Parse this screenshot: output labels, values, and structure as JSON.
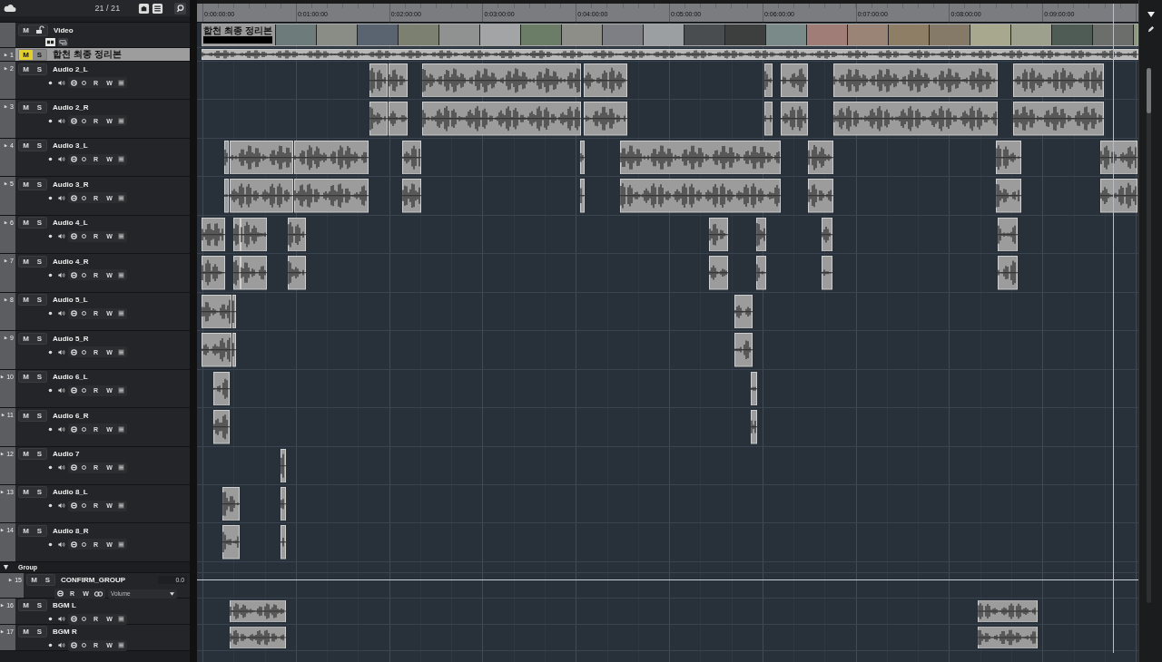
{
  "toolbar": {
    "track_count": "21 / 21"
  },
  "ruler": {
    "labels": [
      "0:00:00:00",
      "0:01:00:00",
      "0:02:00:00",
      "0:03:00:00",
      "0:04:00:00",
      "0:05:00:00",
      "0:06:00:00",
      "0:07:00:00",
      "0:08:00:00",
      "0:09:00:00"
    ]
  },
  "tracks": [
    {
      "kind": "video",
      "name": "Video",
      "mute": "M",
      "muted": false,
      "selected": false,
      "clip_label": "합천 최종 정리본"
    },
    {
      "kind": "mini",
      "number": "1",
      "name": "합천 최종 정리본",
      "mute": "M",
      "solo": "S",
      "muted": true,
      "selected": true
    },
    {
      "kind": "audio",
      "number": "2",
      "name": "Audio 2_L",
      "mute": "M",
      "solo": "S",
      "read": "R",
      "write": "W",
      "muted": false,
      "selected": false
    },
    {
      "kind": "audio",
      "number": "3",
      "name": "Audio 2_R",
      "mute": "M",
      "solo": "S",
      "read": "R",
      "write": "W",
      "muted": false,
      "selected": false
    },
    {
      "kind": "audio",
      "number": "4",
      "name": "Audio 3_L",
      "mute": "M",
      "solo": "S",
      "read": "R",
      "write": "W",
      "muted": false,
      "selected": false
    },
    {
      "kind": "audio",
      "number": "5",
      "name": "Audio 3_R",
      "mute": "M",
      "solo": "S",
      "read": "R",
      "write": "W",
      "muted": false,
      "selected": false
    },
    {
      "kind": "audio",
      "number": "6",
      "name": "Audio 4_L",
      "mute": "M",
      "solo": "S",
      "read": "R",
      "write": "W",
      "muted": false,
      "selected": false
    },
    {
      "kind": "audio",
      "number": "7",
      "name": "Audio 4_R",
      "mute": "M",
      "solo": "S",
      "read": "R",
      "write": "W",
      "muted": false,
      "selected": false
    },
    {
      "kind": "audio",
      "number": "8",
      "name": "Audio 5_L",
      "mute": "M",
      "solo": "S",
      "read": "R",
      "write": "W",
      "muted": false,
      "selected": false
    },
    {
      "kind": "audio",
      "number": "9",
      "name": "Audio 5_R",
      "mute": "M",
      "solo": "S",
      "read": "R",
      "write": "W",
      "muted": false,
      "selected": false
    },
    {
      "kind": "audio",
      "number": "10",
      "name": "Audio 6_L",
      "mute": "M",
      "solo": "S",
      "read": "R",
      "write": "W",
      "muted": false,
      "selected": false
    },
    {
      "kind": "audio",
      "number": "11",
      "name": "Audio 6_R",
      "mute": "M",
      "solo": "S",
      "read": "R",
      "write": "W",
      "muted": false,
      "selected": false
    },
    {
      "kind": "audio",
      "number": "12",
      "name": "Audio 7",
      "mute": "M",
      "solo": "S",
      "read": "R",
      "write": "W",
      "muted": false,
      "selected": false
    },
    {
      "kind": "audio",
      "number": "13",
      "name": "Audio 8_L",
      "mute": "M",
      "solo": "S",
      "read": "R",
      "write": "W",
      "muted": false,
      "selected": false
    },
    {
      "kind": "audio",
      "number": "14",
      "name": "Audio 8_R",
      "mute": "M",
      "solo": "S",
      "read": "R",
      "write": "W",
      "muted": false,
      "selected": false
    },
    {
      "kind": "folder",
      "name": "Group",
      "expanded": true,
      "children": [
        {
          "kind": "group",
          "number": "15",
          "name": "CONFIRM_GROUP",
          "mute": "M",
          "solo": "S",
          "value": "0.0",
          "read": "R",
          "write": "W",
          "automation": "Volume",
          "muted": false,
          "selected": false
        },
        {
          "kind": "audio",
          "number": "16",
          "name": "BGM L",
          "mute": "M",
          "solo": "S",
          "read": "R",
          "write": "W",
          "muted": false,
          "selected": false
        },
        {
          "kind": "audio",
          "number": "17",
          "name": "BGM R",
          "mute": "M",
          "solo": "S",
          "read": "R",
          "write": "W",
          "muted": false,
          "selected": false
        }
      ]
    }
  ]
}
